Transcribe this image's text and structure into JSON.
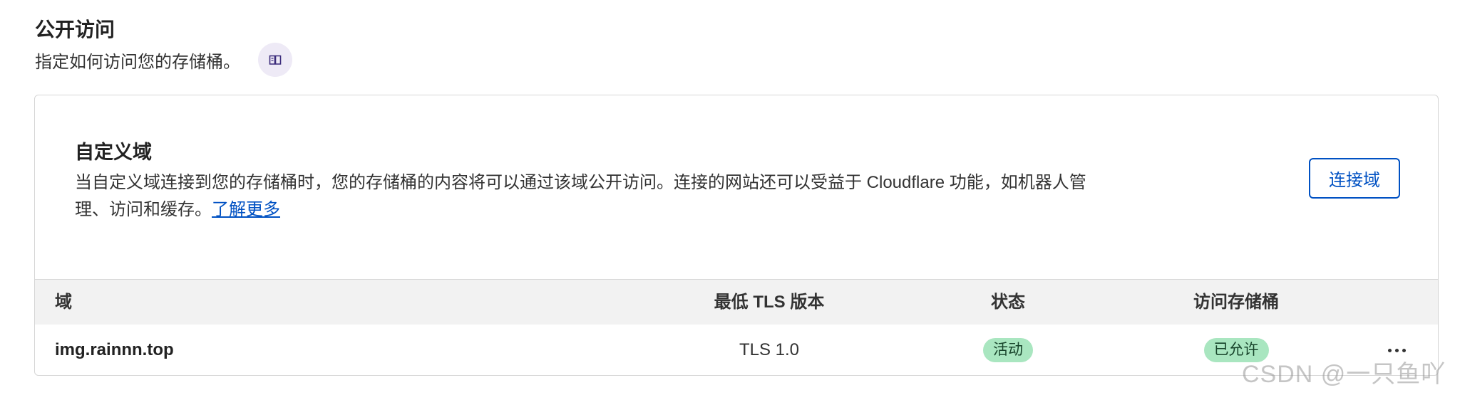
{
  "section": {
    "title": "公开访问",
    "description": "指定如何访问您的存储桶。",
    "doc_icon": "book-icon"
  },
  "custom_domain": {
    "title": "自定义域",
    "description": "当自定义域连接到您的存储桶时，您的存储桶的内容将可以通过该域公开访问。连接的网站还可以受益于 Cloudflare 功能，如机器人管理、访问和缓存。",
    "learn_more": "了解更多",
    "connect_button": "连接域"
  },
  "table": {
    "headers": {
      "domain": "域",
      "tls": "最低 TLS 版本",
      "status": "状态",
      "access": "访问存储桶"
    },
    "rows": [
      {
        "domain": "img.rainnn.top",
        "tls": "TLS 1.0",
        "status": "活动",
        "access": "已允许"
      }
    ]
  },
  "watermark": "CSDN @一只鱼吖",
  "colors": {
    "link": "#0051c3",
    "badge_bg": "#a9e6c0",
    "header_bg": "#f2f2f2"
  }
}
